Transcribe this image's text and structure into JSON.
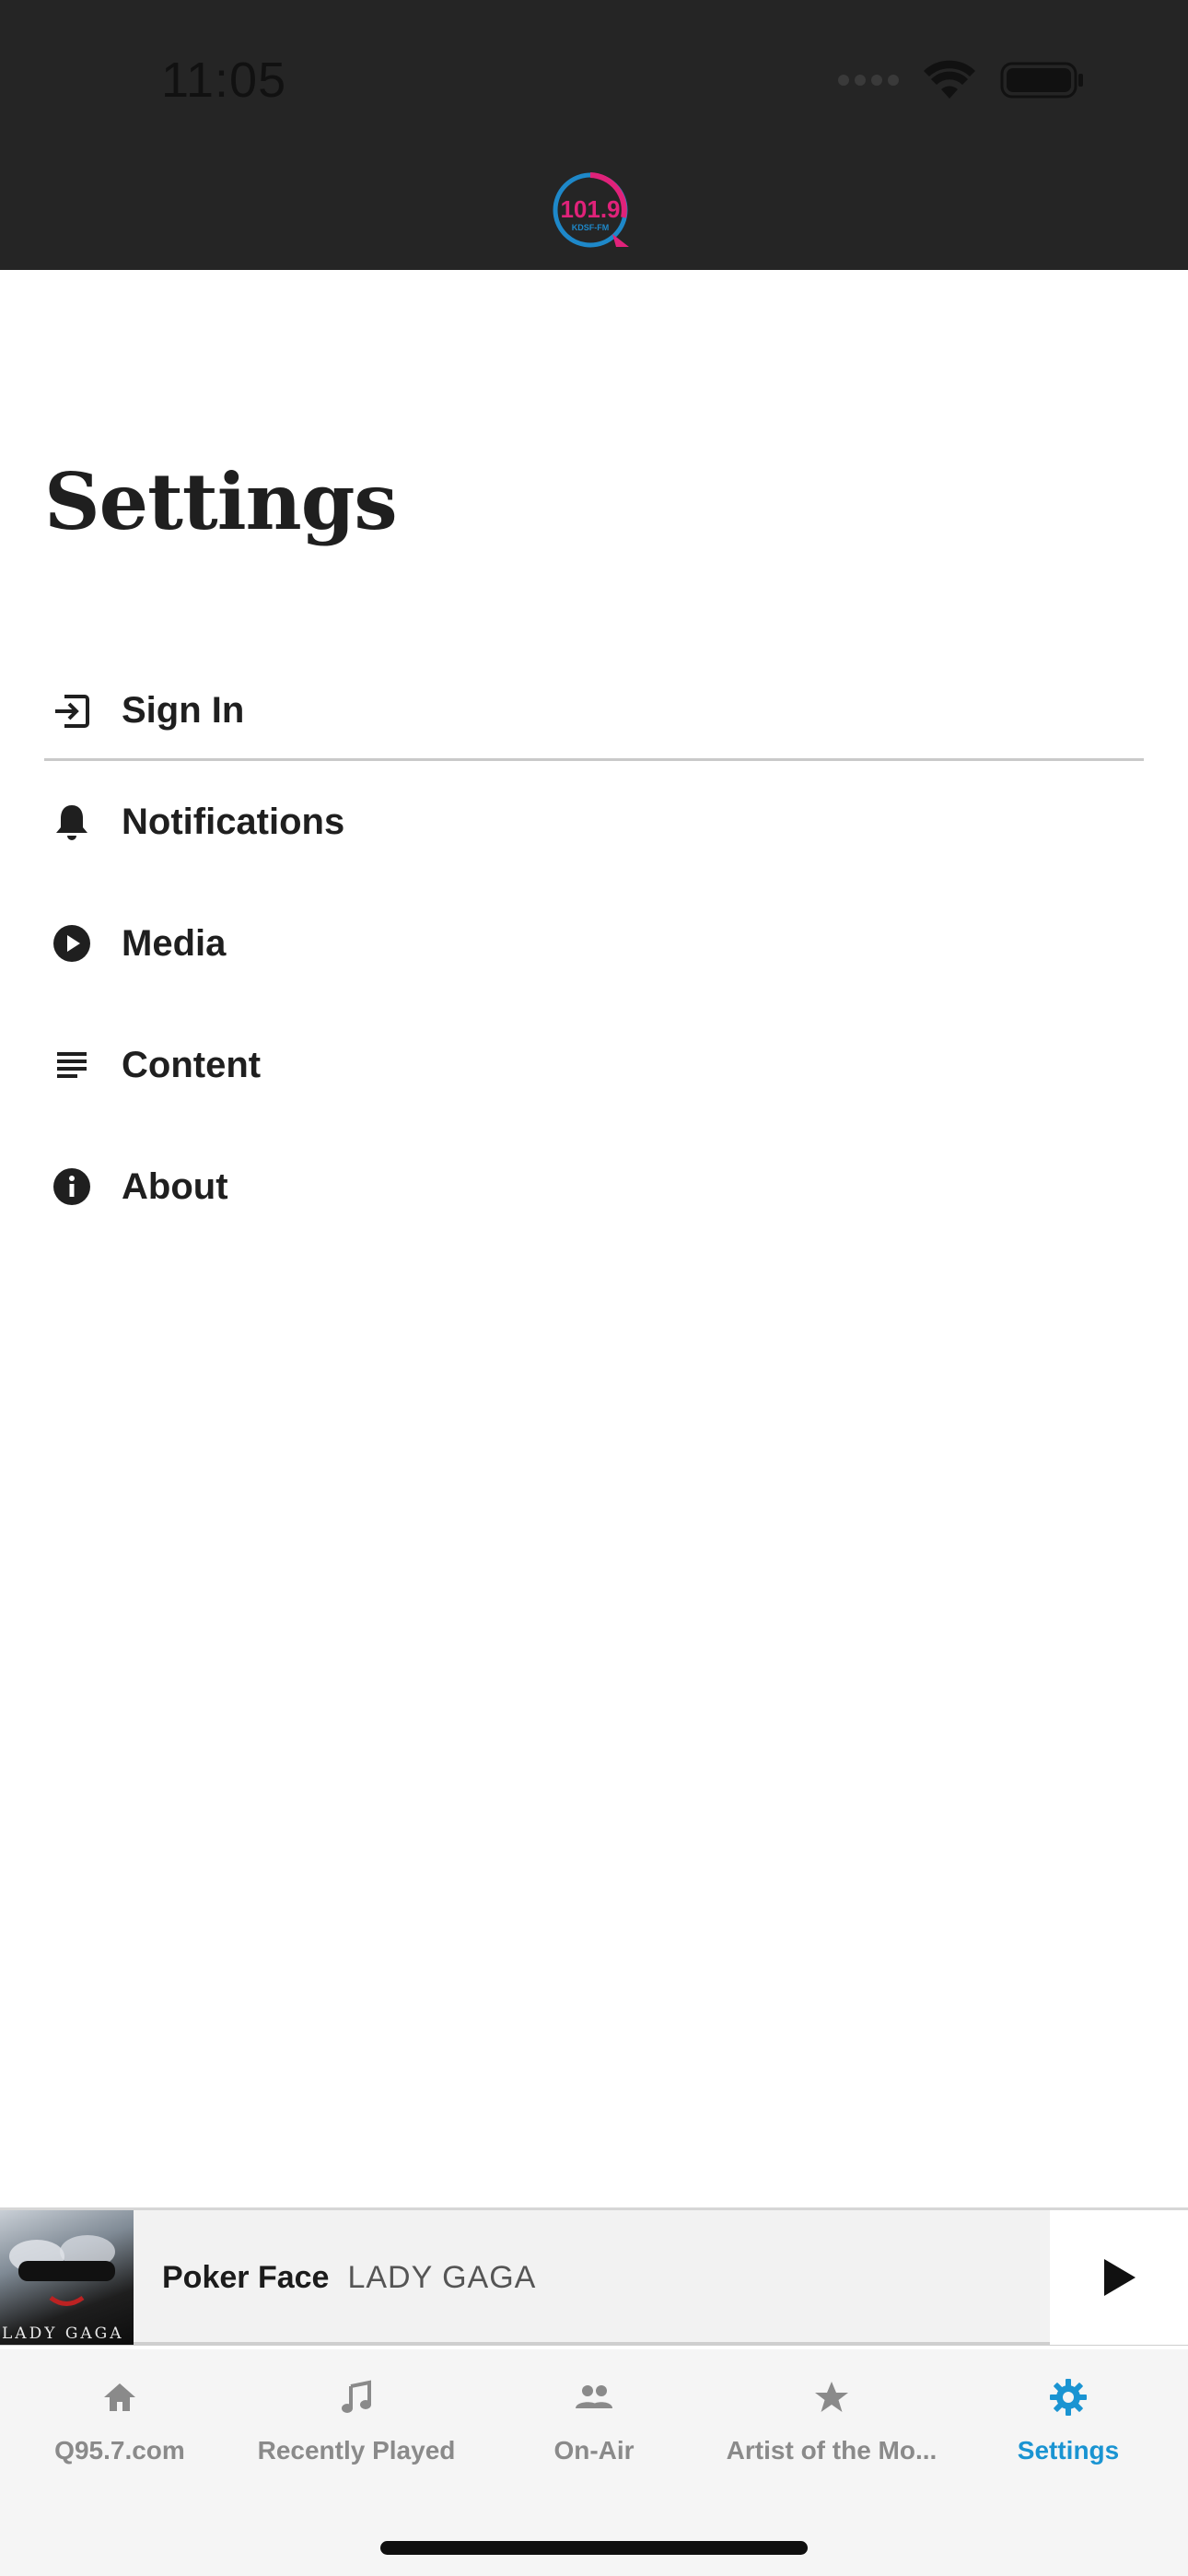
{
  "status_bar": {
    "time": "11:05"
  },
  "header": {
    "logo_text": "101.9",
    "logo_subtext": "KDSF-FM"
  },
  "page": {
    "title": "Settings"
  },
  "menu": [
    {
      "label": "Sign In",
      "icon": "sign-in-icon"
    },
    {
      "label": "Notifications",
      "icon": "bell-icon"
    },
    {
      "label": "Media",
      "icon": "play-circle-icon"
    },
    {
      "label": "Content",
      "icon": "lines-icon"
    },
    {
      "label": "About",
      "icon": "info-icon"
    }
  ],
  "now_playing": {
    "title": "Poker Face",
    "artist": "LADY GAGA",
    "album_caption": "LADY GAGA"
  },
  "tabs": [
    {
      "label": "Q95.7.com",
      "icon": "home-icon"
    },
    {
      "label": "Recently Played",
      "icon": "music-note-icon"
    },
    {
      "label": "On-Air",
      "icon": "people-icon"
    },
    {
      "label": "Artist of the Mo...",
      "icon": "star-icon"
    },
    {
      "label": "Settings",
      "icon": "gear-icon",
      "active": true
    }
  ],
  "colors": {
    "accent": "#1a94d2",
    "header_bg": "#252525",
    "logo_pink": "#e0227a",
    "logo_blue": "#1e88c9"
  }
}
